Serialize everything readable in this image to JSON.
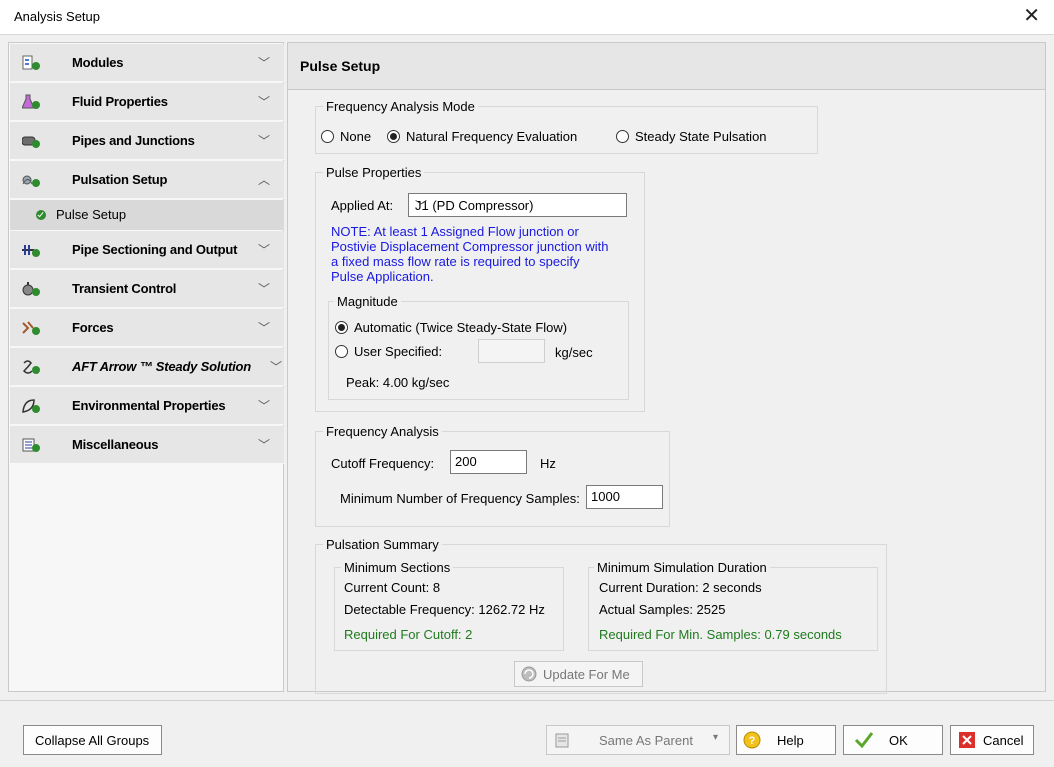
{
  "window": {
    "title": "Analysis Setup",
    "close_glyph": "✕"
  },
  "sidebar": {
    "groups": [
      {
        "label": "Modules",
        "icon": "modules-icon",
        "chevron": "﹀"
      },
      {
        "label": "Fluid Properties",
        "icon": "flask-icon",
        "chevron": "﹀"
      },
      {
        "label": "Pipes and Junctions",
        "icon": "pipe-icon",
        "chevron": "﹀"
      },
      {
        "label": "Pulsation Setup",
        "icon": "pulsation-icon",
        "chevron": "︿"
      },
      {
        "label": "Pipe Sectioning and Output",
        "icon": "sectioning-icon",
        "chevron": "﹀"
      },
      {
        "label": "Transient Control",
        "icon": "stopwatch-icon",
        "chevron": "﹀"
      },
      {
        "label": "Forces",
        "icon": "forces-icon",
        "chevron": "﹀"
      },
      {
        "label": "AFT Arrow ™ Steady Solution",
        "icon": "steady-solution-icon",
        "chevron": "﹀"
      },
      {
        "label": "Environmental Properties",
        "icon": "leaf-icon",
        "chevron": "﹀"
      },
      {
        "label": "Miscellaneous",
        "icon": "misc-icon",
        "chevron": "﹀"
      }
    ],
    "subitem": {
      "label": "Pulse Setup"
    }
  },
  "main": {
    "header": "Pulse Setup",
    "freq_mode": {
      "title": "Frequency Analysis Mode",
      "options": [
        "None",
        "Natural Frequency Evaluation",
        "Steady State Pulsation"
      ],
      "selected": "Natural Frequency Evaluation"
    },
    "pulse_props": {
      "title": "Pulse Properties",
      "applied_label": "Applied At:",
      "applied_value": "J1 (PD Compressor)",
      "note_lines": [
        "NOTE: At least 1 Assigned Flow junction or",
        "Postivie Displacement Compressor junction with",
        "a fixed mass flow rate is required to specify",
        "Pulse Application."
      ],
      "magnitude": {
        "title": "Magnitude",
        "auto_label": "Automatic (Twice Steady-State Flow)",
        "user_label": "User Specified:",
        "user_value": "",
        "unit": "kg/sec",
        "peak": "Peak: 4.00 kg/sec"
      }
    },
    "freq_analysis": {
      "title": "Frequency Analysis",
      "cutoff_label": "Cutoff Frequency:",
      "cutoff_value": "200",
      "cutoff_unit": "Hz",
      "samples_label": "Minimum Number of Frequency Samples:",
      "samples_value": "1000"
    },
    "summary": {
      "title": "Pulsation Summary",
      "sections": {
        "title": "Minimum Sections",
        "count": "Current Count: 8",
        "detectable": "Detectable Frequency: 1262.72 Hz",
        "required": "Required For Cutoff: 2"
      },
      "duration": {
        "title": "Minimum Simulation Duration",
        "current": "Current Duration: 2 seconds",
        "actual": "Actual Samples: 2525",
        "required": "Required For Min. Samples: 0.79 seconds"
      },
      "update_button": "Update For Me"
    }
  },
  "footer": {
    "collapse": "Collapse All Groups",
    "same_as_parent": "Same As Parent",
    "help": "Help",
    "ok": "OK",
    "cancel": "Cancel"
  },
  "colors": {
    "ok_green": "#2e8b2e",
    "note_blue": "#1818e0",
    "required_green": "#1f7a1f",
    "cancel_red": "#d9302b"
  }
}
